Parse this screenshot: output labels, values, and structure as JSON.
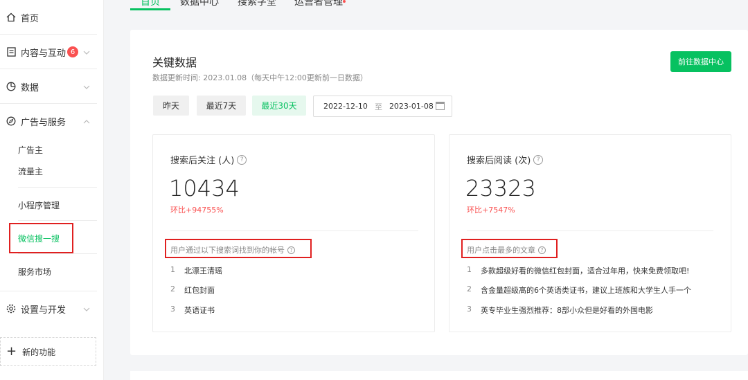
{
  "sidebar": {
    "home": "首页",
    "content": "内容与互动",
    "content_badge": "6",
    "data": "数据",
    "ads": "广告与服务",
    "advertiser": "广告主",
    "publisher": "流量主",
    "miniprogram": "小程序管理",
    "search": "微信搜一搜",
    "market": "服务市场",
    "settings": "设置与开发",
    "new_feature": "新的功能"
  },
  "tabs": [
    "首页",
    "数据中心",
    "搜索字堂",
    "运营者管理"
  ],
  "main": {
    "title": "关键数据",
    "subtitle": "数据更新时间: 2023.01.08（每天中午12:00更新前一日数据）",
    "goto_button": "前往数据中心",
    "ranges": [
      "昨天",
      "最近7天",
      "最近30天"
    ],
    "active_range": "最近30天",
    "date_start": "2022-12-10",
    "date_sep": "至",
    "date_end": "2023-01-08"
  },
  "cards": [
    {
      "label": "搜索后关注 (人)",
      "value": "10434",
      "ratio": "环比+94755%",
      "section": "用户通过以下搜索词找到你的帐号",
      "items": [
        {
          "num": "1",
          "text": "北漂王清瑶"
        },
        {
          "num": "2",
          "text": "红包封面"
        },
        {
          "num": "3",
          "text": "英语证书"
        }
      ]
    },
    {
      "label": "搜索后阅读 (次)",
      "value": "23323",
      "ratio": "环比+7547%",
      "section": "用户点击最多的文章",
      "items": [
        {
          "num": "1",
          "text": "多款超级好看的微信红包封面，适合过年用，快来免费领取吧!"
        },
        {
          "num": "2",
          "text": "含金量超级高的6个英语类证书，建议上班族和大学生人手一个"
        },
        {
          "num": "3",
          "text": "英专毕业生强烈推荐：8部小众但是好看的外国电影"
        }
      ]
    }
  ],
  "colors": {
    "accent": "#07c160",
    "alert": "#fa5151",
    "highlight": "#e02020"
  }
}
